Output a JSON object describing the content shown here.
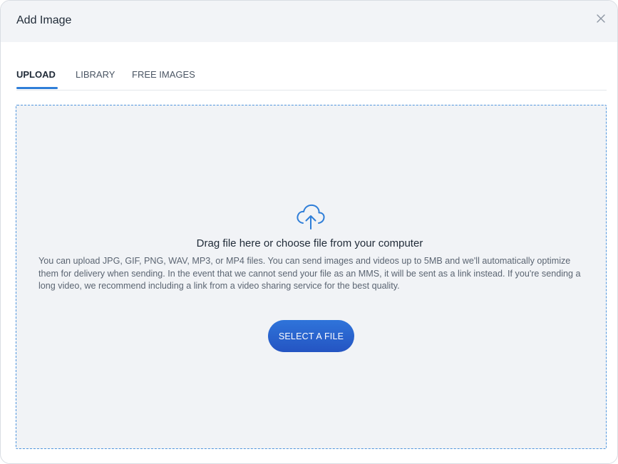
{
  "dialog": {
    "title": "Add Image",
    "close_icon": "close-icon"
  },
  "tabs": [
    {
      "label": "UPLOAD",
      "active": true
    },
    {
      "label": "LIBRARY",
      "active": false
    },
    {
      "label": "FREE IMAGES",
      "active": false
    }
  ],
  "dropzone": {
    "icon": "cloud-upload-icon",
    "heading": "Drag file here or choose file from your computer",
    "description": "You can upload JPG, GIF, PNG, WAV, MP3, or MP4 files. You can send images and videos up to 5MB and we'll automatically optimize them for delivery when sending. In the event that we cannot send your file as an MMS, it will be sent as a link instead. If you're sending a long video, we recommend including a link from a video sharing service for the best quality.",
    "button_label": "SELECT A FILE"
  },
  "colors": {
    "accent": "#2f7ed8",
    "button": "#2454c2",
    "header_bg": "#f2f4f7",
    "dropzone_bg": "#f1f3f6"
  }
}
